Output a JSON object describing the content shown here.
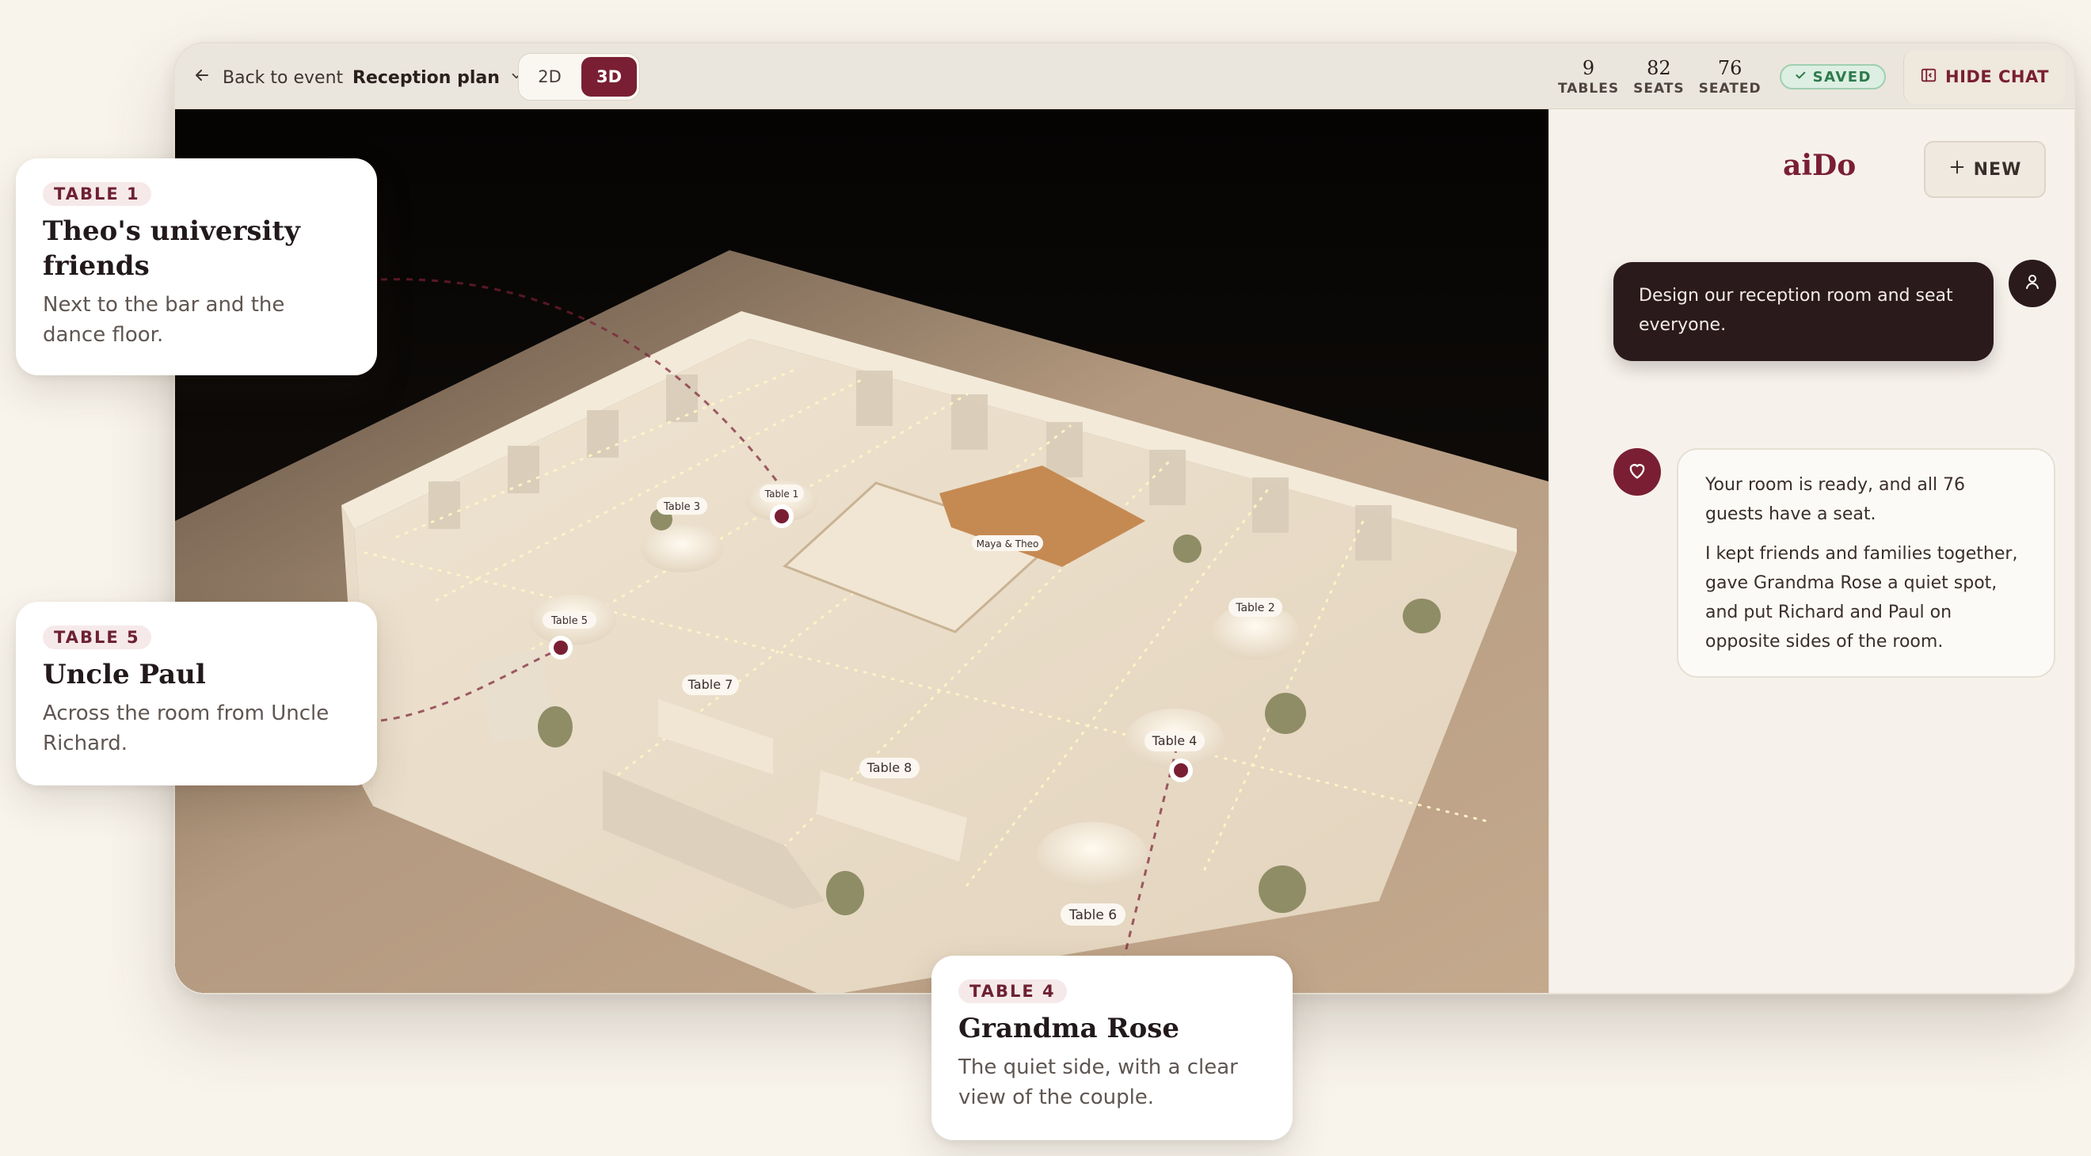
{
  "topbar": {
    "back_label": "Back to event",
    "plan_label": "Reception plan",
    "view_2d": "2D",
    "view_3d": "3D",
    "active_view": "3D",
    "stats": [
      {
        "value": "9",
        "label": "TABLES"
      },
      {
        "value": "82",
        "label": "SEATS"
      },
      {
        "value": "76",
        "label": "SEATED"
      }
    ],
    "saved_label": "SAVED",
    "hide_chat_label": "HIDE CHAT"
  },
  "scene": {
    "table_labels": [
      "Table 1",
      "Table 2",
      "Table 3",
      "Table 4",
      "Table 5",
      "Table 6",
      "Table 7",
      "Table 8",
      "Maya & Theo"
    ]
  },
  "chat": {
    "brand": "aiDo",
    "new_label": "NEW",
    "user_message": "Design our reception room and seat everyone.",
    "assistant_message_1": "Your room is ready, and all 76 guests have a seat.",
    "assistant_message_2": "I kept friends and families together, gave Grandma Rose a quiet spot, and put Richard and Paul on opposite sides of the room."
  },
  "callouts": [
    {
      "tag": "TABLE 1",
      "title": "Theo's university friends",
      "description": "Next to the bar and the dance floor."
    },
    {
      "tag": "TABLE 5",
      "title": "Uncle Paul",
      "description": "Across the room from Uncle Richard."
    },
    {
      "tag": "TABLE 4",
      "title": "Grandma Rose",
      "description": "The quiet side, with a clear view of the couple."
    }
  ],
  "colors": {
    "accent": "#7a1f33",
    "saved_green": "#2e7a4d",
    "dark_bubble": "#2b1a1c",
    "page_bg": "#f8f4ec"
  }
}
